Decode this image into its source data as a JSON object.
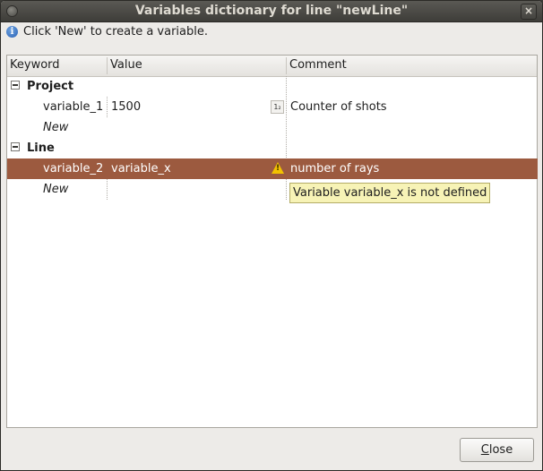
{
  "window": {
    "title": "Variables dictionary for line \"newLine\""
  },
  "info": {
    "icon": "info-icon",
    "text": "Click 'New' to create a variable."
  },
  "table": {
    "columns": [
      "Keyword",
      "Value",
      "Comment"
    ],
    "groups": [
      {
        "name": "Project",
        "rows": [
          {
            "keyword": "variable_1",
            "value": "1500",
            "status_icon": "number-type-icon",
            "comment": "Counter of shots"
          },
          {
            "keyword": "New",
            "value": "",
            "comment": ""
          }
        ]
      },
      {
        "name": "Line",
        "rows": [
          {
            "keyword": "variable_2",
            "value": "variable_x",
            "status_icon": "warning-icon",
            "comment": "number of rays"
          },
          {
            "keyword": "New",
            "value": "",
            "comment": ""
          }
        ]
      }
    ]
  },
  "tooltip": {
    "text": "Variable variable_x is not defined"
  },
  "buttons": {
    "close_first": "C",
    "close_rest": "lose"
  },
  "colors": {
    "selection": "#9c5a3f",
    "tooltip_bg": "#f7f3b6",
    "titlebar": "#4a4945"
  }
}
